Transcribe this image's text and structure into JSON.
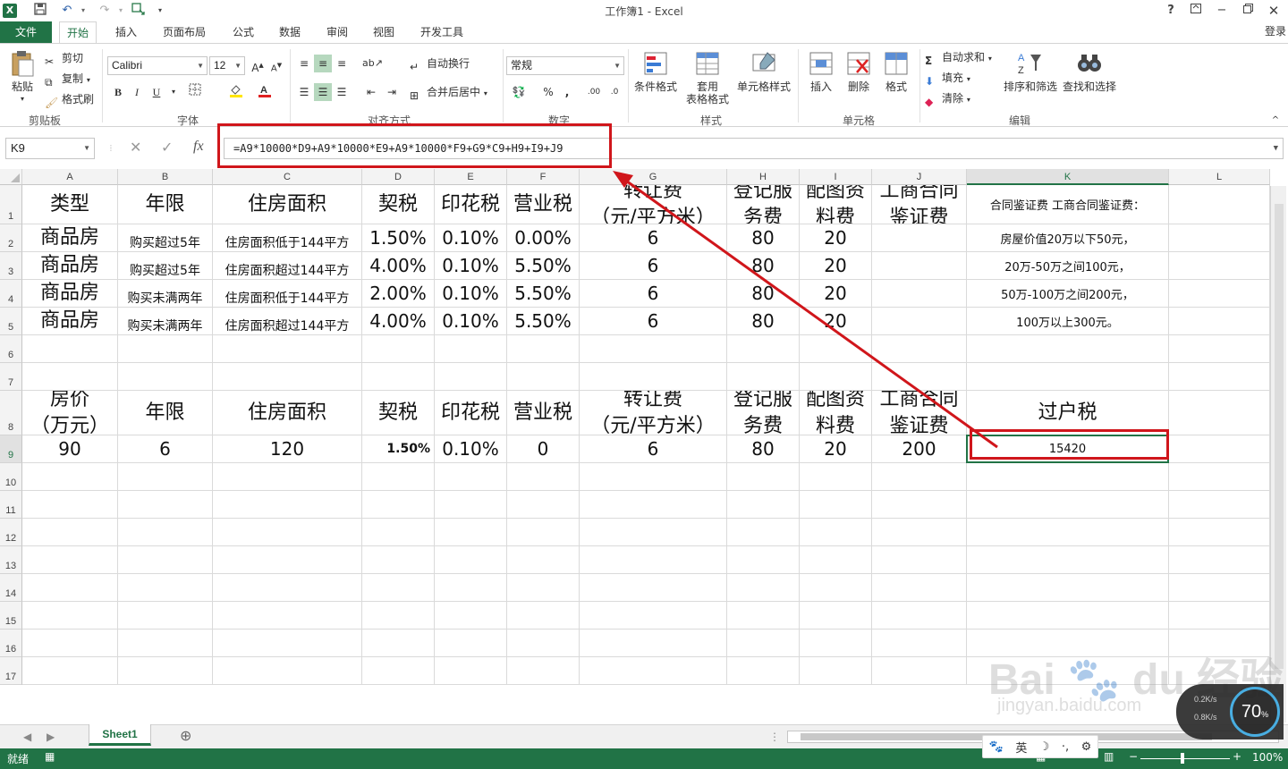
{
  "window": {
    "title": "工作簿1 - Excel",
    "help": "?",
    "login": "登录"
  },
  "quick_access": {
    "save": "💾",
    "undo": "↶",
    "redo": "↷"
  },
  "tabs": {
    "file": "文件",
    "items": [
      "开始",
      "插入",
      "页面布局",
      "公式",
      "数据",
      "审阅",
      "视图",
      "开发工具"
    ],
    "active": "开始"
  },
  "ribbon": {
    "clipboard": {
      "paste": "粘贴",
      "cut": "剪切",
      "copy": "复制",
      "format_painter": "格式刷",
      "label": "剪贴板"
    },
    "font": {
      "name": "Calibri",
      "size": "12",
      "bold": "B",
      "italic": "I",
      "underline": "U",
      "label": "字体"
    },
    "alignment": {
      "wrap": "自动换行",
      "merge": "合并后居中",
      "label": "对齐方式"
    },
    "number": {
      "format": "常规",
      "percent": "%",
      "comma": ",",
      "label": "数字"
    },
    "styles": {
      "conditional": "条件格式",
      "table_l1": "套用",
      "table_l2": "表格格式",
      "cell_styles": "单元格样式",
      "label": "样式"
    },
    "cells": {
      "insert": "插入",
      "delete": "删除",
      "format": "格式",
      "label": "单元格"
    },
    "editing": {
      "autosum": "自动求和",
      "fill": "填充",
      "clear": "清除",
      "sort": "排序和筛选",
      "find": "查找和选择",
      "label": "编辑"
    }
  },
  "formula_bar": {
    "name_box": "K9",
    "fx": "fx",
    "formula": "=A9*10000*D9+A9*10000*E9+A9*10000*F9+G9*C9+H9+I9+J9"
  },
  "columns": [
    "A",
    "B",
    "C",
    "D",
    "E",
    "F",
    "G",
    "H",
    "I",
    "J",
    "K",
    "L"
  ],
  "rows": [
    "1",
    "2",
    "3",
    "4",
    "5",
    "6",
    "7",
    "8",
    "9",
    "10",
    "11",
    "12",
    "13",
    "14",
    "15",
    "16",
    "17"
  ],
  "sheet": {
    "header1": [
      "类型",
      "年限",
      "住房面积",
      "契税",
      "印花税",
      "营业税",
      "转让费\n（元/平方米）",
      "登记服\n务费",
      "配图资\n料费",
      "工商合同\n鉴证费",
      "合同鉴证费 工商合同鉴证费："
    ],
    "r2": [
      "商品房",
      "购买超过5年",
      "住房面积低于144平方",
      "1.50%",
      "0.10%",
      "0.00%",
      "6",
      "80",
      "20",
      "",
      "房屋价值20万以下50元，"
    ],
    "r3": [
      "商品房",
      "购买超过5年",
      "住房面积超过144平方",
      "4.00%",
      "0.10%",
      "5.50%",
      "6",
      "80",
      "20",
      "",
      "20万-50万之间100元，"
    ],
    "r4": [
      "商品房",
      "购买未满两年",
      "住房面积低于144平方",
      "2.00%",
      "0.10%",
      "5.50%",
      "6",
      "80",
      "20",
      "",
      "50万-100万之间200元，"
    ],
    "r5": [
      "商品房",
      "购买未满两年",
      "住房面积超过144平方",
      "4.00%",
      "0.10%",
      "5.50%",
      "6",
      "80",
      "20",
      "",
      "100万以上300元。"
    ],
    "header8": [
      "房价\n（万元）",
      "年限",
      "住房面积",
      "契税",
      "印花税",
      "营业税",
      "转让费\n（元/平方米）",
      "登记服\n务费",
      "配图资\n料费",
      "工商合同\n鉴证费",
      "过户税"
    ],
    "r9": [
      "90",
      "6",
      "120",
      "1.50%",
      "0.10%",
      "0",
      "6",
      "80",
      "20",
      "200",
      "15420"
    ]
  },
  "sheet_tab": "Sheet1",
  "status": {
    "ready": "就绪",
    "zoom": "100%"
  },
  "ime": {
    "lang": "英"
  },
  "netspeed": {
    "percent": "70",
    "up": "0.2K/s",
    "down": "0.8K/s"
  },
  "watermark": {
    "brand": "Bai du 经验",
    "url": "jingyan.baidu.com"
  },
  "colors": {
    "excel_green": "#217346",
    "highlight_red": "#d0161b"
  }
}
